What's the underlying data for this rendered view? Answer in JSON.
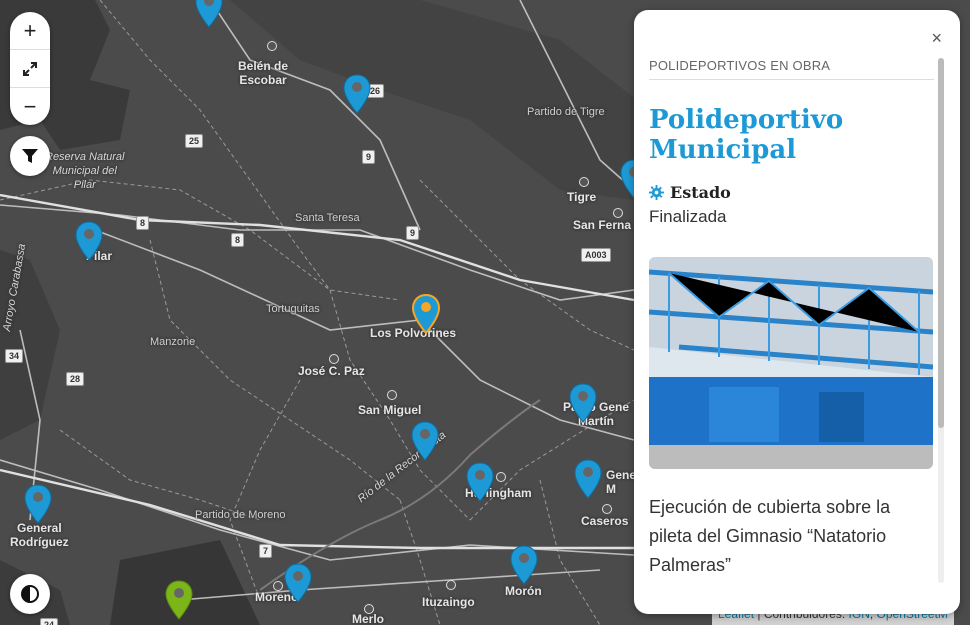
{
  "map": {
    "places": {
      "belen": "Belén de\nEscobar",
      "reserva": "Reserva Natural\nMunicipal del\nPilar",
      "santa_teresa": "Santa Teresa",
      "pilar": "Pilar",
      "tortuguitas": "Tortuguitas",
      "los_polvorines": "Los Polvorines",
      "manzone": "Manzone",
      "jose_c_paz": "José C. Paz",
      "san_miguel": "San Miguel",
      "partido_tigre": "Partido de Tigre",
      "tigre": "Tigre",
      "san_fernando": "San Ferna",
      "pablo_gene": "Pablo Gene\nMartín",
      "gene": "Gene\nM",
      "hurlingham": "Hurlingham",
      "caseros": "Caseros",
      "partido_moreno": "Partido de Moreno",
      "general_rodriguez": "General\nRodríguez",
      "moreno": "Moreno",
      "ituzaingo": "Ituzaingo",
      "moron": "Morón",
      "merlo": "Merlo",
      "rio_reconquista": "Río de la Reconquista",
      "arroyo_carabassa": "Arroyo Carabassa"
    },
    "shields": {
      "r25": "25",
      "r26": "26",
      "r9a": "9",
      "r9b": "9",
      "r8a": "8",
      "r8b": "8",
      "r34": "34",
      "r28": "28",
      "r7": "7",
      "a003": "A003",
      "r24": "24"
    },
    "colors": {
      "marker_blue": "#1d9ad6",
      "marker_selected": "#f5a623",
      "marker_green": "#7cb518"
    }
  },
  "controls": {
    "zoom_in": "+",
    "fullscreen_icon": "expand-icon",
    "zoom_out": "−",
    "filter_icon": "filter-icon",
    "theme_icon": "contrast-icon"
  },
  "panel": {
    "close": "×",
    "category": "POLIDEPORTIVOS EN OBRA",
    "title": "Polideportivo Municipal",
    "estado_label": "Estado",
    "estado_value": "Finalizada",
    "description": "Ejecución de cubierta sobre la pileta del Gimnasio “Natatorio Palmeras”"
  },
  "attribution": {
    "leaflet": "Leaflet",
    "sep": " | Contribuidores: ",
    "ign": "IGN",
    "osm": "OpenStreetM"
  }
}
